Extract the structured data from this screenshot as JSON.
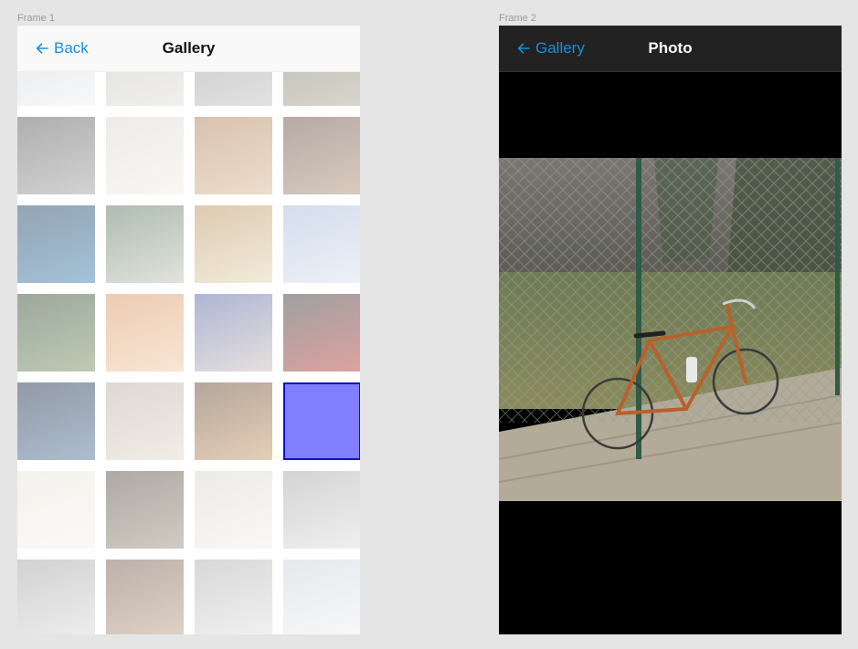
{
  "frames": {
    "frame1_label": "Frame 1",
    "frame2_label": "Frame 2"
  },
  "gallery": {
    "back_label": "Back",
    "title": "Gallery",
    "selected_index": 19,
    "tiles": [
      {
        "colors": [
          "#c8ccd4",
          "#eef0f2"
        ],
        "icon": "photo-wall-sign"
      },
      {
        "colors": [
          "#b8b8b0",
          "#dedcd4"
        ],
        "icon": "photo-building"
      },
      {
        "colors": [
          "#8a8a8a",
          "#bdbdbd"
        ],
        "icon": "photo-tree"
      },
      {
        "colors": [
          "#6b6a58",
          "#a9a48a"
        ],
        "icon": "photo-forest"
      },
      {
        "colors": [
          "#4c4c4c",
          "#9b9b9b"
        ],
        "icon": "photo-alley"
      },
      {
        "colors": [
          "#d9d3cb",
          "#f1ede7"
        ],
        "icon": "photo-room"
      },
      {
        "colors": [
          "#a7774c",
          "#d8b58f"
        ],
        "icon": "photo-bread"
      },
      {
        "colors": [
          "#5c4134",
          "#a98a70"
        ],
        "icon": "photo-chalkboard"
      },
      {
        "colors": [
          "#0f3559",
          "#3577a8"
        ],
        "icon": "photo-neon-street"
      },
      {
        "colors": [
          "#4d6a55",
          "#b9c0b0"
        ],
        "icon": "photo-person-street"
      },
      {
        "colors": [
          "#b38a51",
          "#e4d2ae"
        ],
        "icon": "photo-writing"
      },
      {
        "colors": [
          "#9fb4d6",
          "#d6e0f0"
        ],
        "icon": "photo-purple-cube"
      },
      {
        "colors": [
          "#243d22",
          "#6f8a5a"
        ],
        "icon": "photo-leaves"
      },
      {
        "colors": [
          "#d78c56",
          "#f0c79f"
        ],
        "icon": "photo-warm-blur"
      },
      {
        "colors": [
          "#4b5da0",
          "#c5b9b6"
        ],
        "icon": "photo-girl-hat"
      },
      {
        "colors": [
          "#2c2c2c",
          "#b3302b"
        ],
        "icon": "photo-car"
      },
      {
        "colors": [
          "#0c1f3a",
          "#4b6c93"
        ],
        "icon": "photo-city-night"
      },
      {
        "colors": [
          "#b6a99a",
          "#e0d5c8"
        ],
        "icon": "photo-wedding"
      },
      {
        "colors": [
          "#5a3a20",
          "#c49360"
        ],
        "icon": "photo-arch"
      },
      {
        "colors": [
          "#8080ff",
          "#8080ff"
        ],
        "icon": "placeholder"
      },
      {
        "colors": [
          "#e8e3d8",
          "#f6f2ea"
        ],
        "icon": "photo-pillow"
      },
      {
        "colors": [
          "#4a4036",
          "#9a8a78"
        ],
        "icon": "photo-man-street"
      },
      {
        "colors": [
          "#d7d2cb",
          "#f3f0ec"
        ],
        "icon": "photo-wardrobe"
      },
      {
        "colors": [
          "#9f9f9f",
          "#dcdcdc"
        ],
        "icon": "photo-sleeping"
      },
      {
        "colors": [
          "#9a9a9a",
          "#d8d8d8"
        ],
        "icon": "photo-stairs"
      },
      {
        "colors": [
          "#6b5040",
          "#b79a80"
        ],
        "icon": "photo-street"
      },
      {
        "colors": [
          "#a7a7a7",
          "#e0e0e0"
        ],
        "icon": "photo-building-white"
      },
      {
        "colors": [
          "#c8ccd4",
          "#eef0f2"
        ],
        "icon": "photo-wall-sign"
      }
    ]
  },
  "photo_view": {
    "back_label": "Gallery",
    "title": "Photo",
    "image_icon": "bicycle-photo"
  }
}
